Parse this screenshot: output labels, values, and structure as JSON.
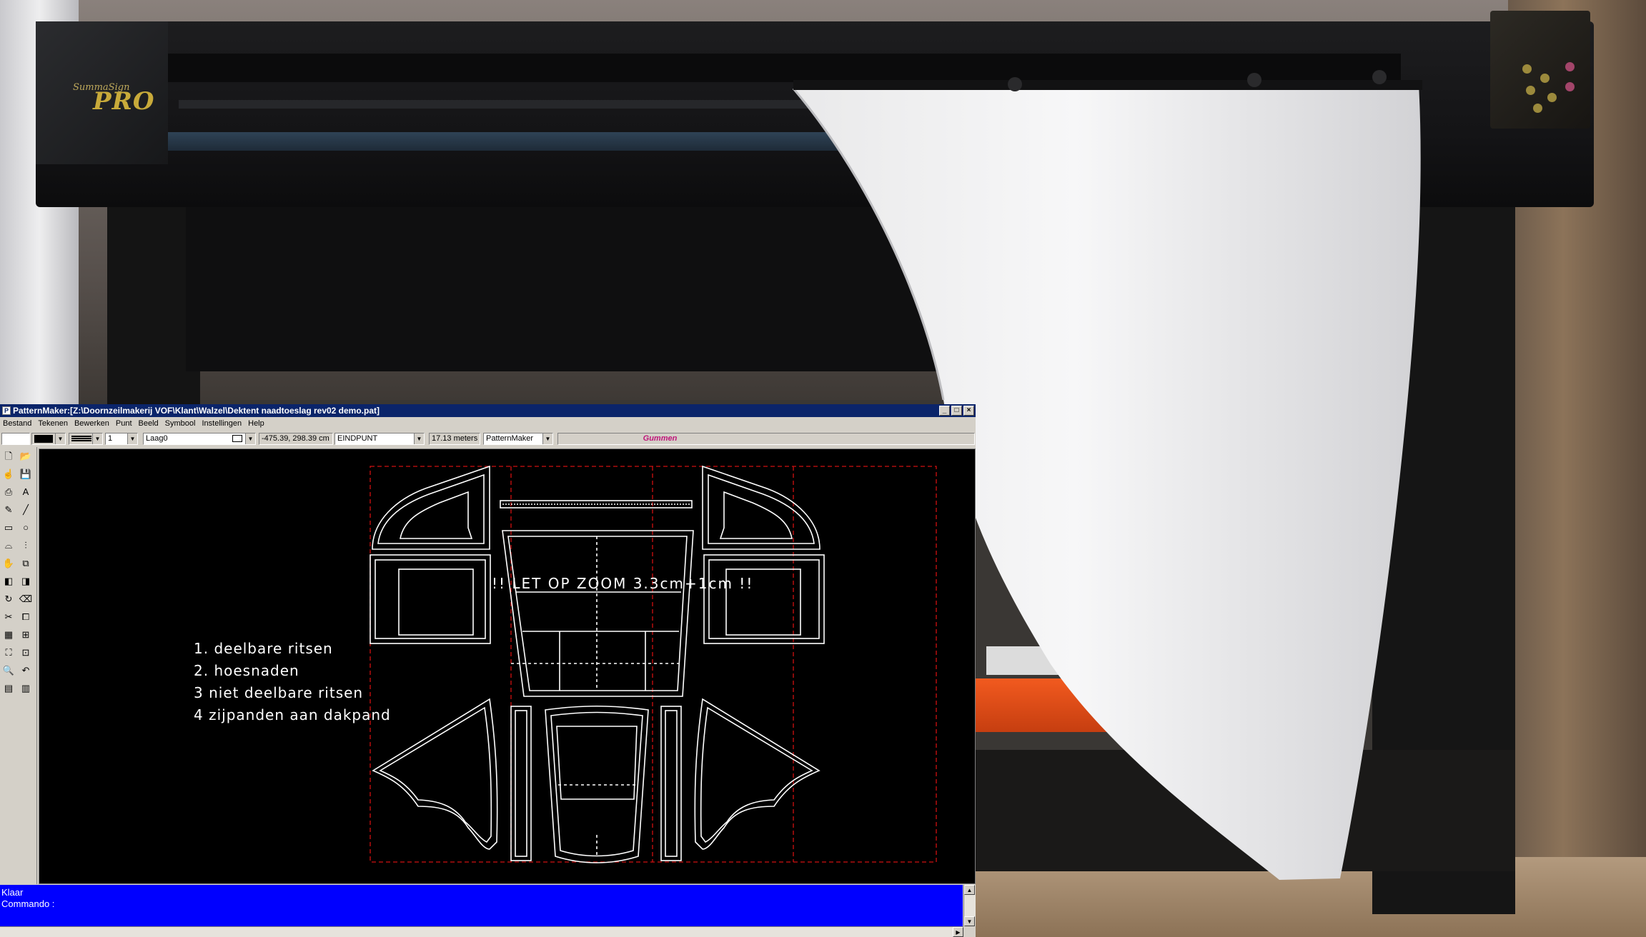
{
  "window": {
    "title": "PatternMaker:[Z:\\Doornzeilmakerij VOF\\Klant\\Walzel\\Dektent naadtoeslag rev02 demo.pat]",
    "buttons": [
      "_",
      "□",
      "×"
    ]
  },
  "photo": {
    "brand_small": "SummaSign",
    "brand_big": "PRO"
  },
  "menu": [
    "Bestand",
    "Tekenen",
    "Bewerken",
    "Punt",
    "Beeld",
    "Symbool",
    "Instellingen",
    "Help"
  ],
  "toolbar": {
    "line_width": "1",
    "layer": "Laag0",
    "coordinates": "-475.39, 298.39 cm",
    "snap_mode": "EINDPUNT",
    "length": "17.13 meters",
    "mode": "PatternMaker",
    "active_command": "Gummen",
    "active_command_color": "#c0157a"
  },
  "canvas": {
    "legend": [
      "1. deelbare ritsen",
      "2. hoesnaden",
      "3 niet deelbare ritsen",
      "4 zijpanden aan dakpand"
    ],
    "note": "!! LET OP ZOOM 3.3cm+1cm !!",
    "sheet_border_color": "#d01010"
  },
  "status": {
    "line1": "Klaar",
    "line2": "Commando :"
  },
  "colors": {
    "title_bar": "#0a246a",
    "status_bar": "#0000ff",
    "canvas_bg": "#000000"
  }
}
